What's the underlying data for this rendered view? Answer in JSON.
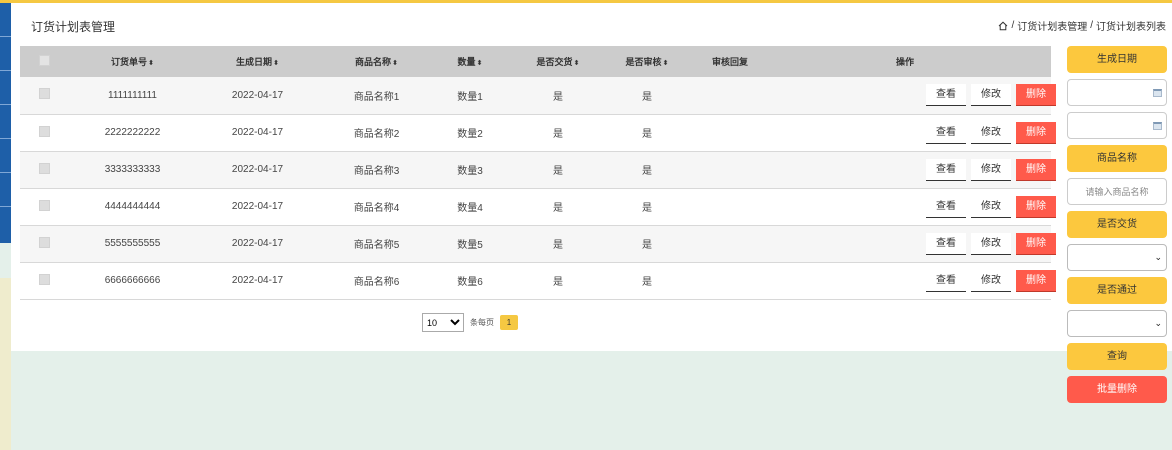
{
  "page": {
    "title": "订货计划表管理",
    "breadcrumb": [
      "订货计划表管理",
      "订货计划表列表"
    ],
    "breadcrumb_sep": "/"
  },
  "table": {
    "headers": [
      "订货单号",
      "生成日期",
      "商品名称",
      "数量",
      "是否交货",
      "是否审核",
      "审核回复",
      "操作"
    ],
    "sort_icon": "⬍",
    "rows": [
      {
        "code": "1111111111",
        "date": "2022-04-17",
        "name": "商品名称1",
        "qty": "数量1",
        "delivered": "是",
        "audited": "是",
        "reply": ""
      },
      {
        "code": "2222222222",
        "date": "2022-04-17",
        "name": "商品名称2",
        "qty": "数量2",
        "delivered": "是",
        "audited": "是",
        "reply": ""
      },
      {
        "code": "3333333333",
        "date": "2022-04-17",
        "name": "商品名称3",
        "qty": "数量3",
        "delivered": "是",
        "audited": "是",
        "reply": ""
      },
      {
        "code": "4444444444",
        "date": "2022-04-17",
        "name": "商品名称4",
        "qty": "数量4",
        "delivered": "是",
        "audited": "是",
        "reply": ""
      },
      {
        "code": "5555555555",
        "date": "2022-04-17",
        "name": "商品名称5",
        "qty": "数量5",
        "delivered": "是",
        "audited": "是",
        "reply": ""
      },
      {
        "code": "6666666666",
        "date": "2022-04-17",
        "name": "商品名称6",
        "qty": "数量6",
        "delivered": "是",
        "audited": "是",
        "reply": ""
      }
    ],
    "actions": {
      "view": "查看",
      "edit": "修改",
      "delete": "删除"
    }
  },
  "pager": {
    "page_size": "10",
    "per_page_label": "条每页",
    "current_page": "1"
  },
  "sidebar": {
    "date_label": "生成日期",
    "date_from": "",
    "date_to": "",
    "name_label": "商品名称",
    "name_placeholder": "请输入商品名称",
    "delivered_label": "是否交货",
    "delivered_value": "",
    "passed_label": "是否通过",
    "passed_value": "",
    "search_button": "查询",
    "batch_delete_button": "批量删除"
  },
  "colors": {
    "accent_yellow": "#fcc83e",
    "danger_red": "#ff5a4b",
    "nav_blue": "#1e5fa8",
    "header_gray": "#cccccc"
  },
  "icons": {
    "home": "home-icon",
    "calendar": "calendar-icon",
    "chevron": "chevron-down-icon",
    "sort": "sort-icon"
  }
}
